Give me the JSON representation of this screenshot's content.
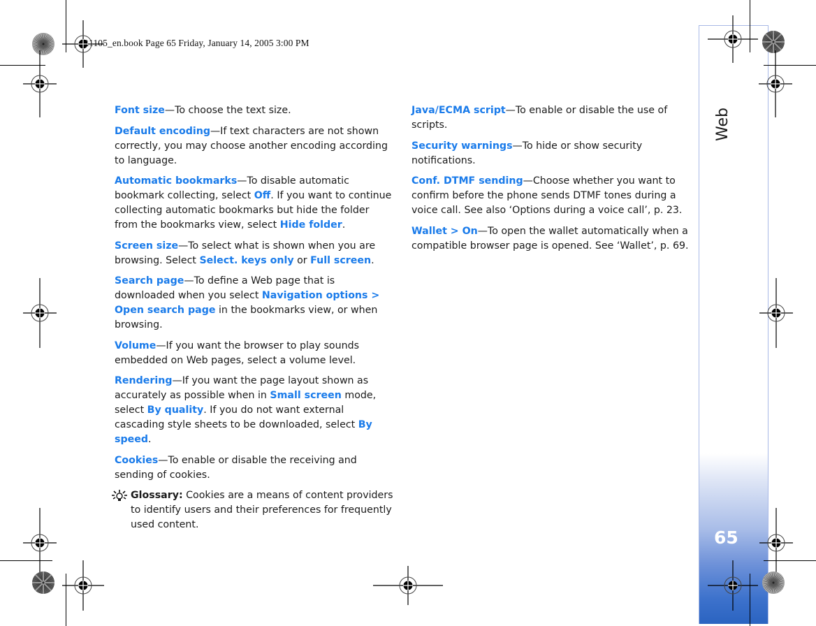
{
  "header": {
    "print_info": "R1105_en.book  Page 65  Friday, January 14, 2005  3:00 PM"
  },
  "section": {
    "title": "Web",
    "page_number": "65"
  },
  "colors": {
    "keyword": "#1a7bea",
    "tab_border": "#a8b9e6",
    "tab_gradient_bottom": "#2a63c0"
  },
  "left_column": [
    {
      "parts": [
        {
          "k": "Font size"
        },
        {
          "t": "—To choose the text size."
        }
      ]
    },
    {
      "parts": [
        {
          "k": "Default encoding"
        },
        {
          "t": "—If text characters are not shown correctly, you may choose another encoding according to language."
        }
      ]
    },
    {
      "parts": [
        {
          "k": "Automatic bookmarks"
        },
        {
          "t": "—To disable automatic bookmark collecting, select "
        },
        {
          "k": "Off"
        },
        {
          "t": ". If you want to continue collecting automatic bookmarks but hide the folder from the bookmarks view, select "
        },
        {
          "k": "Hide folder"
        },
        {
          "t": "."
        }
      ]
    },
    {
      "parts": [
        {
          "k": "Screen size"
        },
        {
          "t": "—To select what is shown when you are browsing. Select "
        },
        {
          "k": "Select. keys only"
        },
        {
          "t": " or "
        },
        {
          "k": "Full screen"
        },
        {
          "t": "."
        }
      ]
    },
    {
      "parts": [
        {
          "k": "Search page"
        },
        {
          "t": "—To define a Web page that is downloaded when you select "
        },
        {
          "k": "Navigation options > Open search page"
        },
        {
          "t": " in the bookmarks view, or when browsing."
        }
      ]
    },
    {
      "parts": [
        {
          "k": "Volume"
        },
        {
          "t": "—If you want the browser to play sounds embedded on Web pages, select a volume level."
        }
      ]
    },
    {
      "parts": [
        {
          "k": "Rendering"
        },
        {
          "t": "—If you want the page layout shown as accurately as possible when in "
        },
        {
          "k": "Small screen"
        },
        {
          "t": " mode, select "
        },
        {
          "k": "By quality"
        },
        {
          "t": ". If you do not want external cascading style sheets to be downloaded, select "
        },
        {
          "k": "By speed"
        },
        {
          "t": "."
        }
      ]
    },
    {
      "parts": [
        {
          "k": "Cookies"
        },
        {
          "t": "—To enable or disable the receiving and sending of cookies."
        }
      ]
    }
  ],
  "glossary": {
    "icon": "lightbulb-icon",
    "label": "Glossary:",
    "text": " Cookies are a means of content providers to identify users and their preferences for frequently used content."
  },
  "right_column": [
    {
      "parts": [
        {
          "k": "Java/ECMA script"
        },
        {
          "t": "—To enable or disable the use of scripts."
        }
      ]
    },
    {
      "parts": [
        {
          "k": "Security warnings"
        },
        {
          "t": "—To hide or show security notifications."
        }
      ]
    },
    {
      "parts": [
        {
          "k": "Conf. DTMF sending"
        },
        {
          "t": "—Choose whether you want to confirm before the phone sends DTMF tones during a voice call. See also ‘Options during a voice call’, p. 23."
        }
      ]
    },
    {
      "parts": [
        {
          "k": "Wallet > On"
        },
        {
          "t": "—To open the wallet automatically when a compatible browser page is opened. See ‘Wallet’, p. 69."
        }
      ]
    }
  ],
  "marks": {
    "registration_icon": "crosshair-registration-icon",
    "color_wheel_icon": "color-wheel-icon"
  }
}
